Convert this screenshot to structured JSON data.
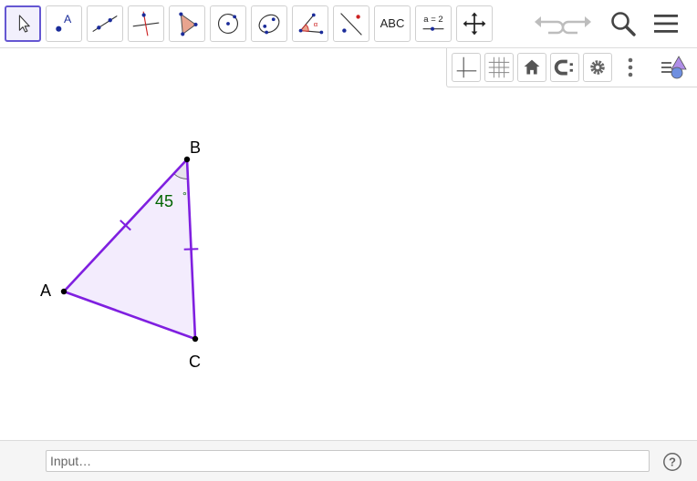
{
  "toolbar": {
    "tools": [
      {
        "id": "move",
        "icon": "arrow-cursor-icon",
        "active": true
      },
      {
        "id": "point",
        "icon": "point-icon",
        "label": "A"
      },
      {
        "id": "line",
        "icon": "line-through-points-icon"
      },
      {
        "id": "perpendicular",
        "icon": "perpendicular-line-icon"
      },
      {
        "id": "polygon",
        "icon": "polygon-icon"
      },
      {
        "id": "circle",
        "icon": "circle-center-point-icon"
      },
      {
        "id": "conic",
        "icon": "ellipse-icon"
      },
      {
        "id": "angle",
        "icon": "angle-icon"
      },
      {
        "id": "reflect",
        "icon": "reflect-about-line-icon"
      },
      {
        "id": "text",
        "icon": "text-icon",
        "label": "ABC"
      },
      {
        "id": "slider",
        "icon": "slider-icon",
        "label": "a = 2"
      },
      {
        "id": "move-view",
        "icon": "move-graphics-view-icon"
      }
    ],
    "right": [
      "undo-icon",
      "redo-icon",
      "search-icon",
      "menu-icon"
    ]
  },
  "stylebar": [
    "axes-icon",
    "grid-icon",
    "home-icon",
    "point-capturing-icon",
    "gear-icon",
    "more-vertical-icon",
    "toggle-stylebar-icon"
  ],
  "construction": {
    "points": [
      {
        "name": "A",
        "label": "A"
      },
      {
        "name": "B",
        "label": "B"
      },
      {
        "name": "C",
        "label": "C"
      }
    ],
    "angle": {
      "vertex": "B",
      "value": "45",
      "unit": "°"
    },
    "colors": {
      "polygon_stroke": "#7f1fe0",
      "polygon_fill": "#f3ecfd",
      "angle_label": "#006400",
      "points": "#000000"
    }
  },
  "input_bar": {
    "placeholder": "Input…",
    "value": "",
    "help_icon": "help-icon"
  }
}
